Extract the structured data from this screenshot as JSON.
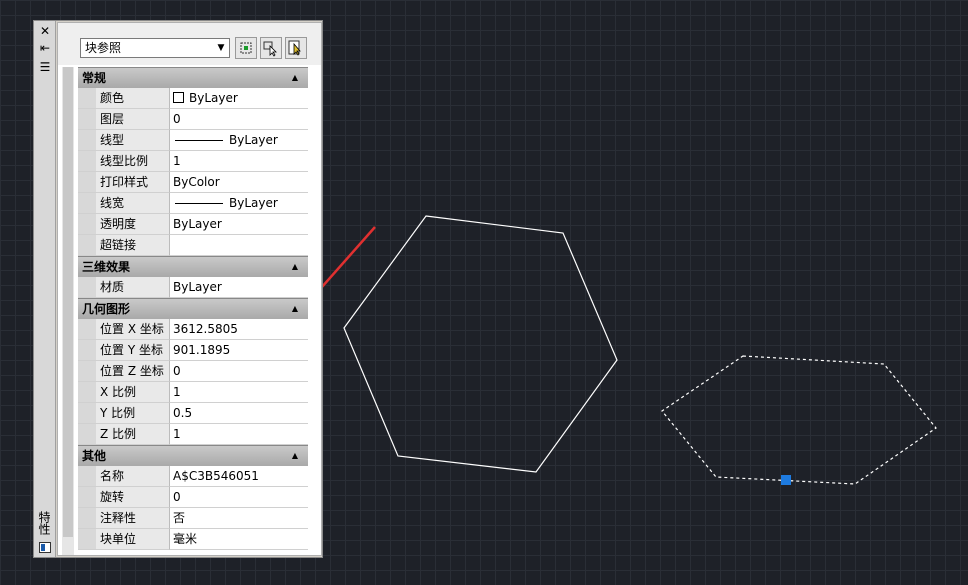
{
  "palette": {
    "side_title": "特性",
    "close_glyph": "✕",
    "autohide_glyph": "⇤",
    "menu_glyph": "☰",
    "object_type": "块参照",
    "toolbar": {
      "quick_select_icon": "quick-select-icon",
      "select_objects_icon": "select-objects-icon",
      "pickadd_icon": "pickadd-toggle-icon"
    },
    "sections": [
      {
        "title": "常规",
        "rows": [
          {
            "label": "颜色",
            "value": "ByLayer",
            "swatch": "#ffffff"
          },
          {
            "label": "图层",
            "value": "0"
          },
          {
            "label": "线型",
            "value": "ByLayer"
          },
          {
            "label": "线型比例",
            "value": "1"
          },
          {
            "label": "打印样式",
            "value": "ByColor"
          },
          {
            "label": "线宽",
            "value": "ByLayer"
          },
          {
            "label": "透明度",
            "value": "ByLayer"
          },
          {
            "label": "超链接",
            "value": ""
          }
        ]
      },
      {
        "title": "三维效果",
        "rows": [
          {
            "label": "材质",
            "value": "ByLayer"
          }
        ]
      },
      {
        "title": "几何图形",
        "rows": [
          {
            "label": "位置 X 坐标",
            "value": "3612.5805"
          },
          {
            "label": "位置 Y 坐标",
            "value": "901.1895"
          },
          {
            "label": "位置 Z 坐标",
            "value": "0"
          },
          {
            "label": "X 比例",
            "value": "1"
          },
          {
            "label": "Y 比例",
            "value": "0.5"
          },
          {
            "label": "Z 比例",
            "value": "1"
          }
        ]
      },
      {
        "title": "其他",
        "rows": [
          {
            "label": "名称",
            "value": "A$C3B546051"
          },
          {
            "label": "旋转",
            "value": "0"
          },
          {
            "label": "注释性",
            "value": "否"
          },
          {
            "label": "块单位",
            "value": "毫米"
          }
        ]
      }
    ]
  },
  "canvas": {
    "background": "#1e2128",
    "hexagon_color": "#ffffff",
    "grip_color": "#1e7be0",
    "arrow_color": "#e03030"
  }
}
